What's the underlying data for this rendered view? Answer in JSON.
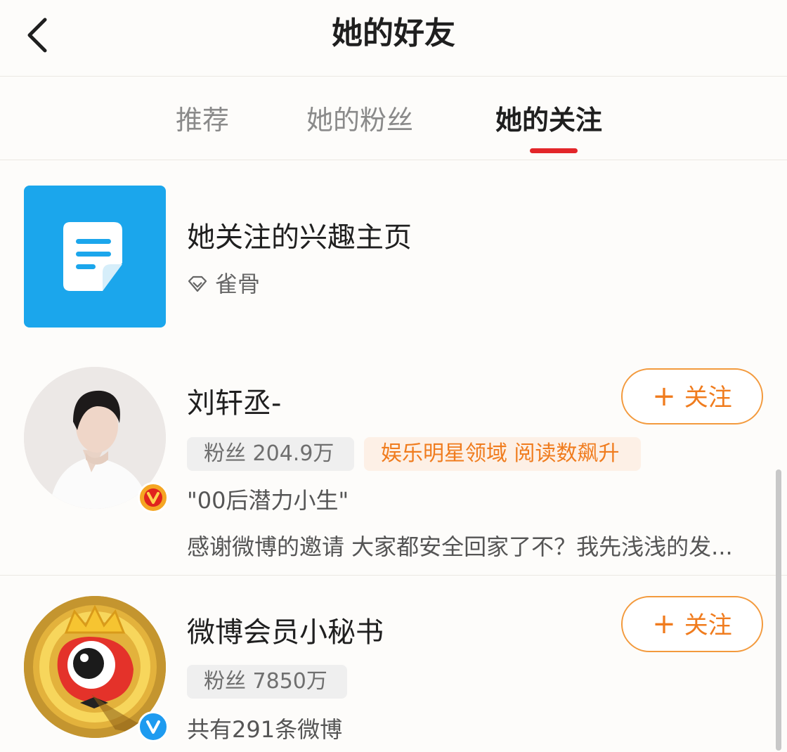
{
  "header": {
    "title": "她的好友"
  },
  "tabs": [
    {
      "label": "推荐"
    },
    {
      "label": "她的粉丝"
    },
    {
      "label": "她的关注",
      "active": true
    }
  ],
  "interest_page": {
    "title": "她关注的兴趣主页",
    "tag": "雀骨",
    "thumb_icon": "document-icon",
    "thumb_color": "#1ba6ec"
  },
  "users": [
    {
      "name": "刘轩丞-",
      "follow_label": "关注",
      "followers_label": "粉丝 204.9万",
      "highlight_tag": "娱乐明星领域 阅读数飙升",
      "verified_badge": "orange-v-badge",
      "description": "\"00后潜力小生\"",
      "latest_post": "感谢微博的邀请 大家都安全回家了不？我先浅浅的发..."
    },
    {
      "name": "微博会员小秘书",
      "follow_label": "关注",
      "followers_label": "粉丝 7850万",
      "verified_badge": "blue-v-badge",
      "post_count_text": "共有291条微博"
    }
  ],
  "colors": {
    "accent": "#f07c1e",
    "tab_indicator": "#e3262a",
    "blue_verified": "#1e9bf0",
    "orange_verified": "#f5a623"
  }
}
